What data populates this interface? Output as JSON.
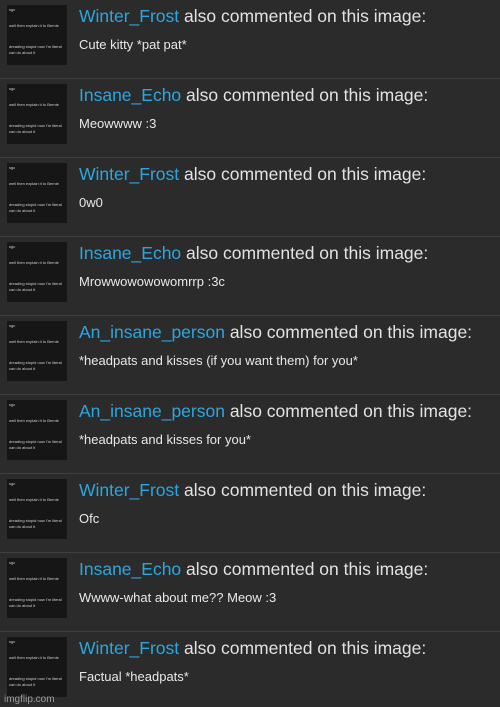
{
  "thumbnail": {
    "line1": "sgc",
    "line2": "well then explain it to Bernie",
    "line3": "dreading stupid now I'm literal",
    "line4": "can do about it"
  },
  "notifications": [
    {
      "user": "Winter_Frost",
      "action": "also commented on this image:",
      "comment": "Cute kitty *pat pat*"
    },
    {
      "user": "Insane_Echo",
      "action": "also commented on this image:",
      "comment": "Meowwww :3"
    },
    {
      "user": "Winter_Frost",
      "action": "also commented on this image:",
      "comment": "0w0"
    },
    {
      "user": "Insane_Echo",
      "action": "also commented on this image:",
      "comment": "Mrowwowowowomrrp :3c"
    },
    {
      "user": "An_insane_person",
      "action": "also commented on this image:",
      "comment": "*headpats and kisses (if you want them) for you*"
    },
    {
      "user": "An_insane_person",
      "action": "also commented on this image:",
      "comment": "*headpats and kisses for you*"
    },
    {
      "user": "Winter_Frost",
      "action": "also commented on this image:",
      "comment": "Ofc"
    },
    {
      "user": "Insane_Echo",
      "action": "also commented on this image:",
      "comment": "Wwww-what about me?? Meow :3"
    },
    {
      "user": "Winter_Frost",
      "action": "also commented on this image:",
      "comment": "Factual *headpats*"
    }
  ],
  "watermark": "imgflip.com",
  "colors": {
    "background": "#2b2b2b",
    "username": "#2ba7e0",
    "text": "#e2e2e2",
    "divider": "#3f3f3f"
  }
}
